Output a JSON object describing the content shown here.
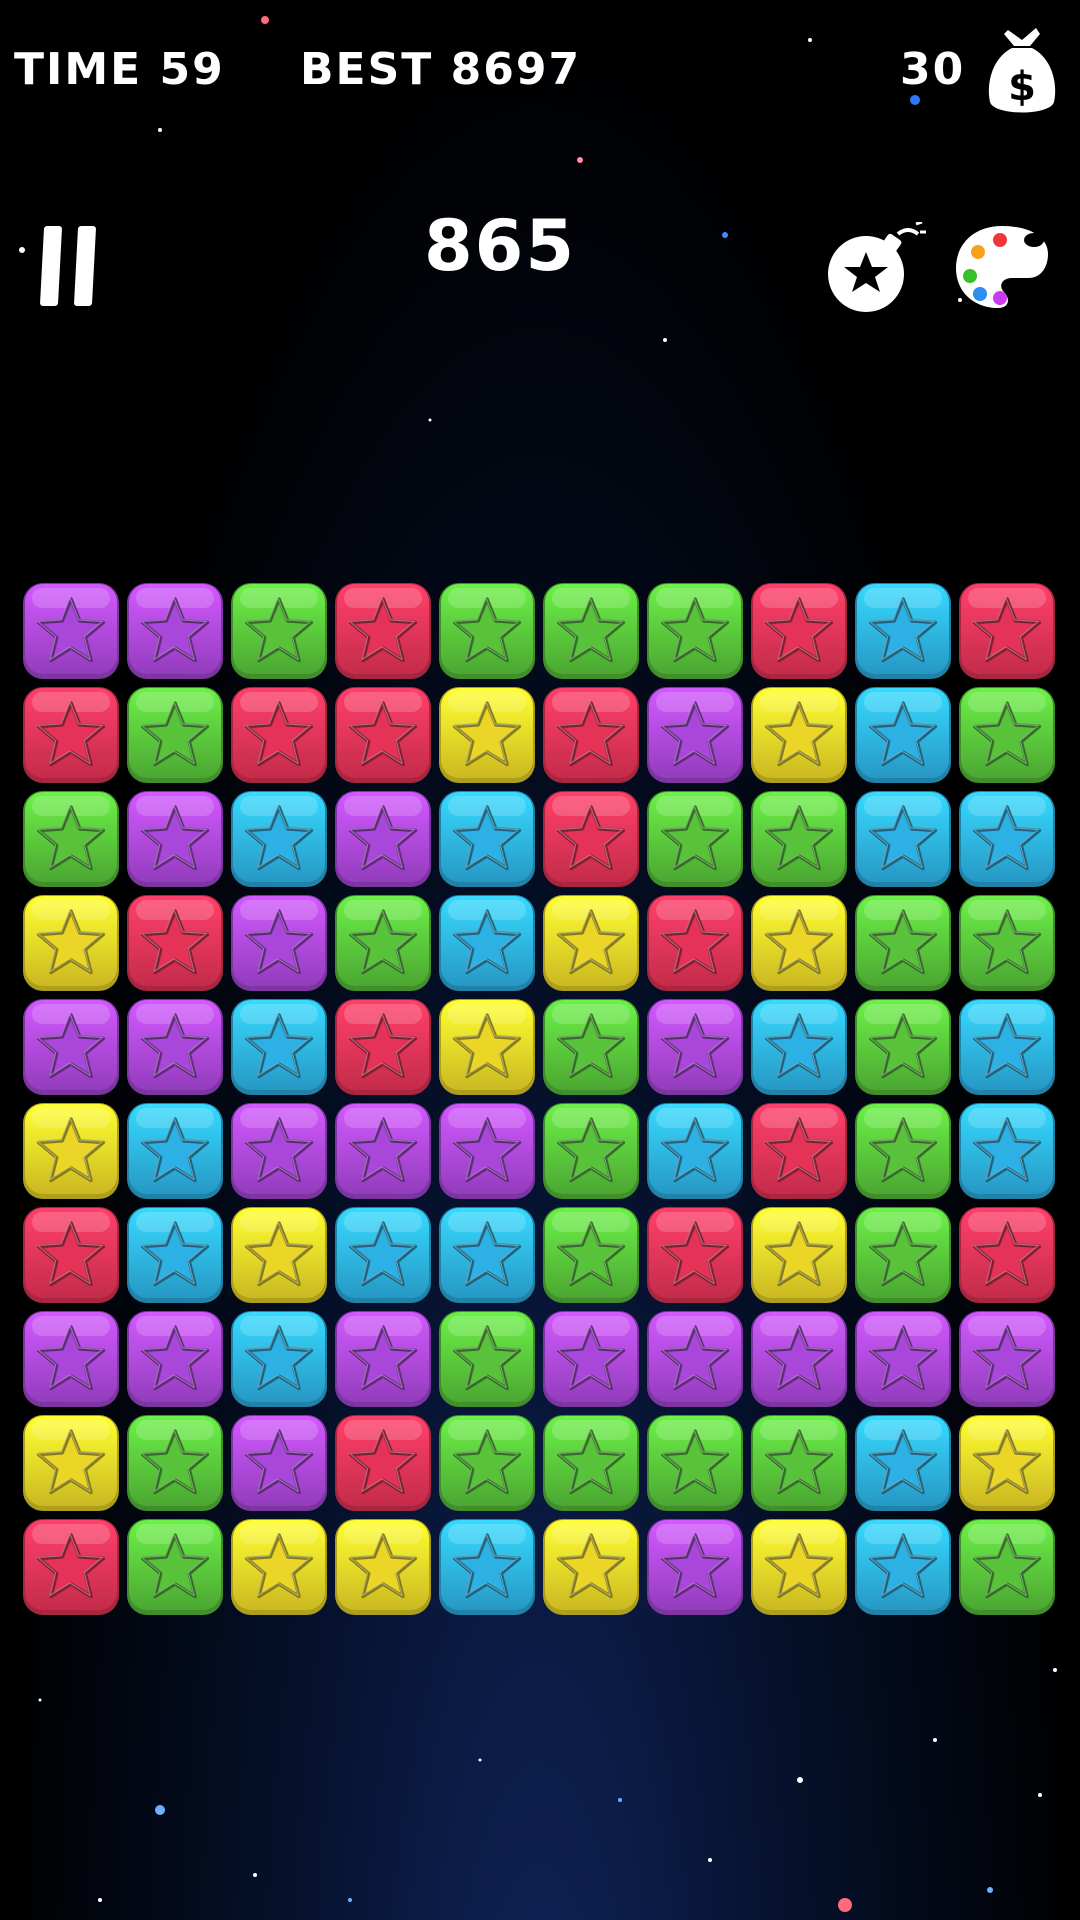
{
  "hud": {
    "time_text": "TIME 59",
    "best_text": "BEST 8697",
    "coins": "30",
    "score": "865"
  },
  "icons": {
    "pause": "pause-icon",
    "coin_bag": "money-bag-icon",
    "bomb": "bomb-icon",
    "palette": "palette-icon"
  },
  "colors": {
    "purple": "#b34be6",
    "green": "#5ccc3d",
    "red": "#f0365a",
    "blue": "#2fb9f0",
    "yellow": "#f7e12a"
  },
  "board": {
    "rows": 10,
    "cols": 10,
    "grid": [
      [
        "purple",
        "purple",
        "green",
        "red",
        "green",
        "green",
        "green",
        "red",
        "blue",
        "red"
      ],
      [
        "red",
        "green",
        "red",
        "red",
        "yellow",
        "red",
        "purple",
        "yellow",
        "blue",
        "green"
      ],
      [
        "green",
        "purple",
        "blue",
        "purple",
        "blue",
        "red",
        "green",
        "green",
        "blue",
        "blue"
      ],
      [
        "yellow",
        "red",
        "purple",
        "green",
        "blue",
        "yellow",
        "red",
        "yellow",
        "green",
        "green"
      ],
      [
        "purple",
        "purple",
        "blue",
        "red",
        "yellow",
        "green",
        "purple",
        "blue",
        "green",
        "blue"
      ],
      [
        "yellow",
        "blue",
        "purple",
        "purple",
        "purple",
        "green",
        "blue",
        "red",
        "green",
        "blue"
      ],
      [
        "red",
        "blue",
        "yellow",
        "blue",
        "blue",
        "green",
        "red",
        "yellow",
        "green",
        "red"
      ],
      [
        "purple",
        "purple",
        "blue",
        "purple",
        "green",
        "purple",
        "purple",
        "purple",
        "purple",
        "purple"
      ],
      [
        "yellow",
        "green",
        "purple",
        "red",
        "green",
        "green",
        "green",
        "green",
        "blue",
        "yellow"
      ],
      [
        "red",
        "green",
        "yellow",
        "yellow",
        "blue",
        "yellow",
        "purple",
        "yellow",
        "blue",
        "green"
      ]
    ]
  }
}
